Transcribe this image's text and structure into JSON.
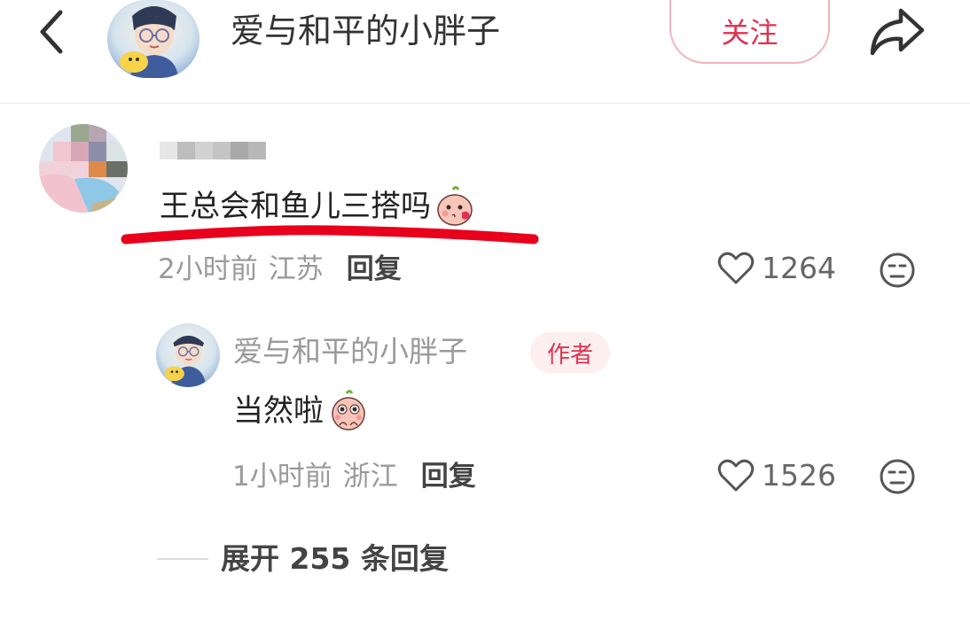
{
  "header": {
    "title": "爱与和平的小胖子",
    "follow_label": "关注",
    "back_icon": "chevron-left-icon",
    "share_icon": "share-arrow-icon"
  },
  "comment": {
    "text": "王总会和鱼儿三搭吗",
    "emoji": "peach-kiss-emoji",
    "time": "2小时前",
    "location": "江苏",
    "reply_label": "回复",
    "likes": "1264",
    "username_visible": false
  },
  "reply": {
    "author": "爱与和平的小胖子",
    "badge": "作者",
    "text": "当然啦",
    "emoji": "peach-peek-emoji",
    "time": "1小时前",
    "location": "浙江",
    "reply_label": "回复",
    "likes": "1526"
  },
  "expand": {
    "label": "展开 255 条回复"
  },
  "colors": {
    "accent": "#e03250",
    "underline": "#e8001c",
    "muted": "#9a9a9a"
  }
}
